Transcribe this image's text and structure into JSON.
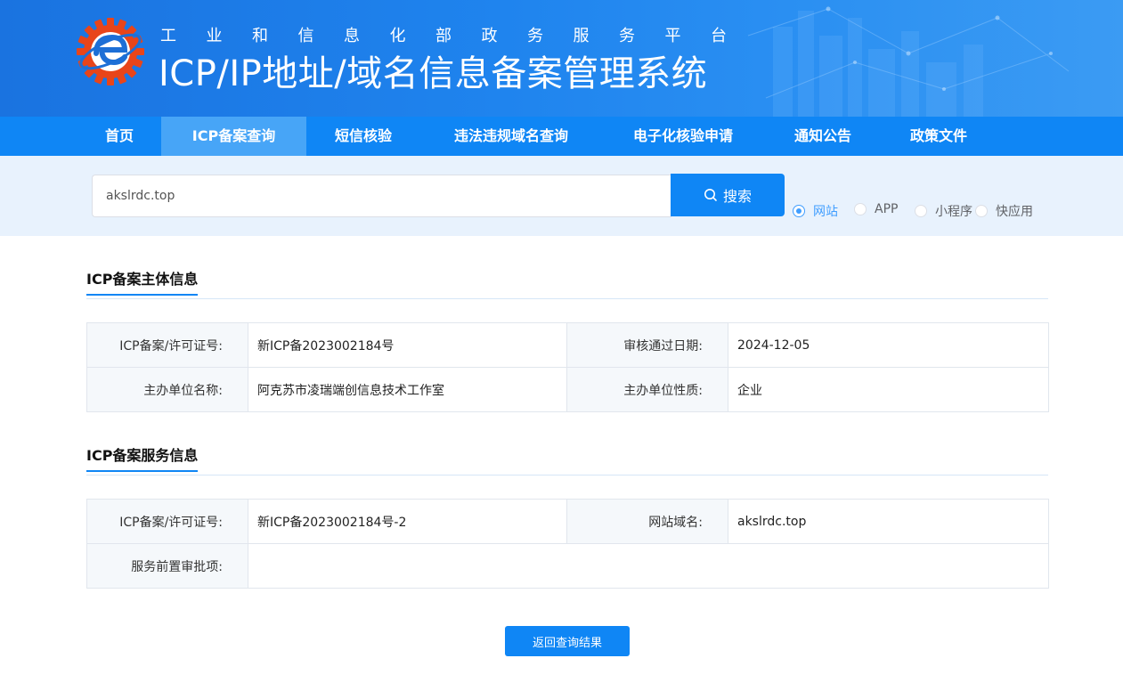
{
  "header": {
    "subtitle": "工业和信息化部政务服务平台",
    "title": "ICP/IP地址/域名信息备案管理系统",
    "logo_icon": "gear-e-logo-icon"
  },
  "nav": {
    "items": [
      {
        "label": "首页",
        "active": false
      },
      {
        "label": "ICP备案查询",
        "active": true
      },
      {
        "label": "短信核验",
        "active": false
      },
      {
        "label": "违法违规域名查询",
        "active": false
      },
      {
        "label": "电子化核验申请",
        "active": false
      },
      {
        "label": "通知公告",
        "active": false
      },
      {
        "label": "政策文件",
        "active": false
      }
    ]
  },
  "search": {
    "value": "akslrdc.top",
    "button_label": "搜索",
    "button_icon": "search-icon",
    "types": [
      {
        "label": "网站",
        "checked": true
      },
      {
        "label": "APP",
        "checked": false
      },
      {
        "label": "小程序",
        "checked": false
      },
      {
        "label": "快应用",
        "checked": false
      }
    ]
  },
  "subject_info": {
    "title": "ICP备案主体信息",
    "rows": [
      {
        "label1": "ICP备案/许可证号:",
        "value1": "新ICP备2023002184号",
        "label2": "审核通过日期:",
        "value2": "2024-12-05"
      },
      {
        "label1": "主办单位名称:",
        "value1": "阿克苏市凌瑞端创信息技术工作室",
        "label2": "主办单位性质:",
        "value2": "企业"
      }
    ]
  },
  "service_info": {
    "title": "ICP备案服务信息",
    "row1": {
      "label1": "ICP备案/许可证号:",
      "value1": "新ICP备2023002184号-2",
      "label2": "网站域名:",
      "value2": "akslrdc.top"
    },
    "row2": {
      "label": "服务前置审批项:",
      "value": ""
    }
  },
  "back_button_label": "返回查询结果",
  "colors": {
    "primary": "#0f86f5",
    "nav_active": "#47a5f7",
    "search_band": "#e8f2fd",
    "radio_checked": "#409eff"
  }
}
